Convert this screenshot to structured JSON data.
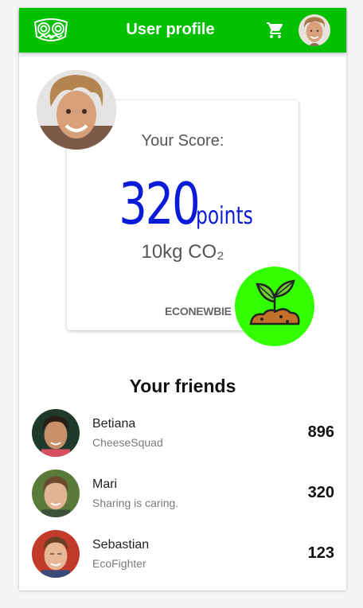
{
  "header": {
    "title": "User profile",
    "logo_icon": "owl-logo-icon",
    "cart_icon": "shopping-cart-icon",
    "brand_color": "#00c000"
  },
  "score_card": {
    "label": "Your Score:",
    "value": "320",
    "unit": "points",
    "co2": "10kg CO₂",
    "rank": "ECONEWBIE",
    "badge_icon": "sprout-icon",
    "accent_color": "#0a1bd8",
    "badge_color": "#33ff00"
  },
  "friends": {
    "title": "Your friends",
    "items": [
      {
        "name": "Betiana",
        "team": "CheeseSquad",
        "score": "896"
      },
      {
        "name": "Mari",
        "team": "Sharing is caring.",
        "score": "320"
      },
      {
        "name": "Sebastian",
        "team": "EcoFighter",
        "score": "123"
      }
    ]
  }
}
